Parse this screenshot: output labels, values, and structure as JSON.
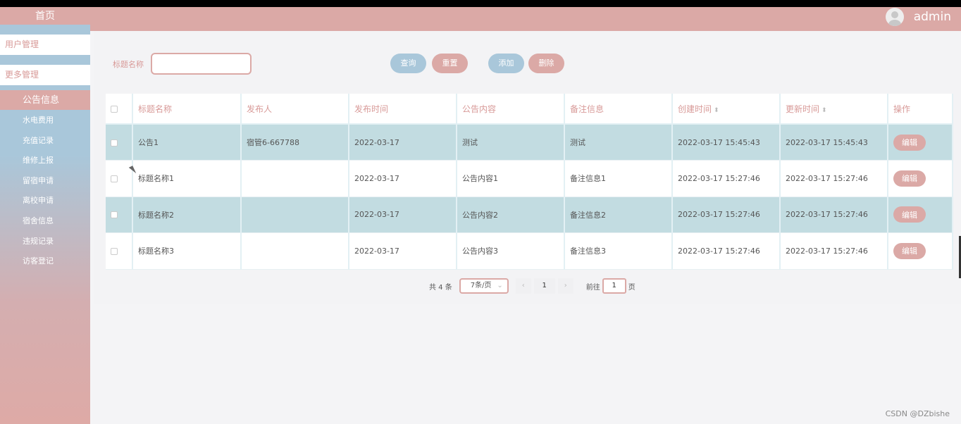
{
  "header": {
    "username": "admin"
  },
  "sidebar": {
    "home": "首页",
    "user_mgmt": "用户管理",
    "more_mgmt": "更多管理",
    "section": "公告信息",
    "items": [
      "水电费用",
      "充值记录",
      "维修上报",
      "留宿申请",
      "离校申请",
      "宿舍信息",
      "违规记录",
      "访客登记"
    ]
  },
  "search": {
    "label": "标题名称",
    "value": ""
  },
  "buttons": {
    "query": "查询",
    "reset": "重置",
    "add": "添加",
    "delete": "删除"
  },
  "table": {
    "headers": [
      "标题名称",
      "发布人",
      "发布时间",
      "公告内容",
      "备注信息",
      "创建时间",
      "更新时间",
      "操作"
    ],
    "rows": [
      {
        "title": "公告1",
        "publisher": "宿管6-667788",
        "pub_time": "2022-03-17",
        "content": "测试",
        "remark": "测试",
        "created": "2022-03-17 15:45:43",
        "updated": "2022-03-17 15:45:43",
        "action": "编辑"
      },
      {
        "title": "标题名称1",
        "publisher": "",
        "pub_time": "2022-03-17",
        "content": "公告内容1",
        "remark": "备注信息1",
        "created": "2022-03-17 15:27:46",
        "updated": "2022-03-17 15:27:46",
        "action": "编辑"
      },
      {
        "title": "标题名称2",
        "publisher": "",
        "pub_time": "2022-03-17",
        "content": "公告内容2",
        "remark": "备注信息2",
        "created": "2022-03-17 15:27:46",
        "updated": "2022-03-17 15:27:46",
        "action": "编辑"
      },
      {
        "title": "标题名称3",
        "publisher": "",
        "pub_time": "2022-03-17",
        "content": "公告内容3",
        "remark": "备注信息3",
        "created": "2022-03-17 15:27:46",
        "updated": "2022-03-17 15:27:46",
        "action": "编辑"
      }
    ]
  },
  "pagination": {
    "total": "共 4 条",
    "page_size": "7条/页",
    "current_page": "1",
    "goto_label": "前往",
    "goto_value": "1",
    "page_suffix": "页"
  },
  "watermark": "CSDN @DZbishe",
  "colors": {
    "pink": "#dba9a6",
    "blue": "#a9c7da",
    "row_alt": "#c2dce1"
  }
}
